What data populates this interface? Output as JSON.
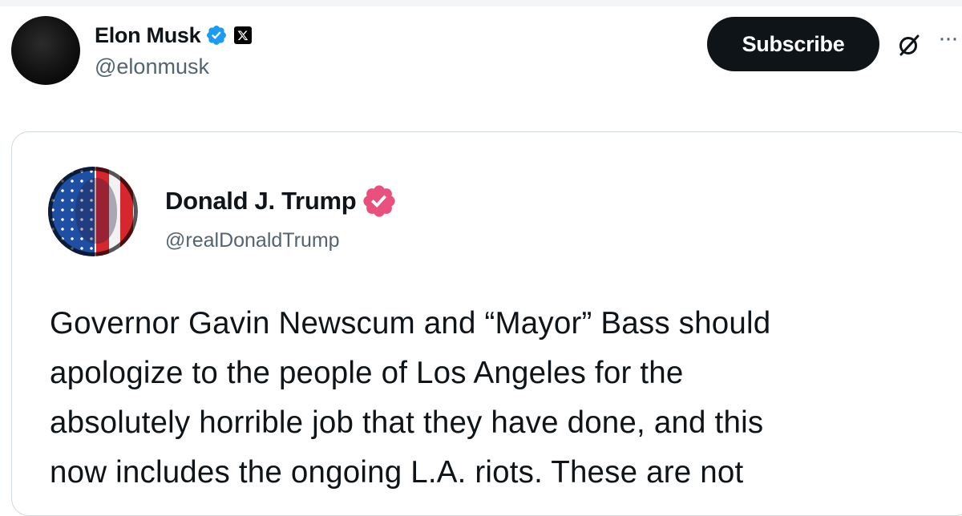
{
  "post": {
    "author": {
      "name": "Elon Musk",
      "handle": "@elonmusk"
    },
    "subscribe_label": "Subscribe",
    "more_label": "···"
  },
  "quoted_post": {
    "author": {
      "name": "Donald J. Trump",
      "handle": "@realDonaldTrump"
    },
    "text_lines": [
      "Governor Gavin Newscum and “Mayor” Bass should",
      "apologize to the people of Los Angeles for the",
      "absolutely horrible job that they have done, and this",
      "now includes the ongoing L.A. riots. These are not"
    ]
  },
  "colors": {
    "verified_blue": "#1d9bf0",
    "verified_pink": "#e8507d",
    "subscribe_bg": "#0f1419",
    "handle_gray": "#536471",
    "card_border": "#cfd9de"
  },
  "icons": {
    "verified": "verified-badge-icon",
    "affiliate": "x-logo-icon",
    "grok": "grok-icon",
    "more": "more-icon",
    "verified_pink": "verified-pink-badge-icon"
  }
}
